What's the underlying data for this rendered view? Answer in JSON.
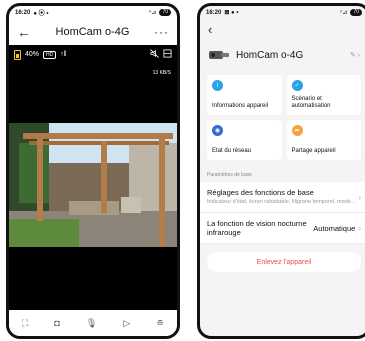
{
  "phone1": {
    "status": {
      "time": "16:20",
      "battery": "70"
    },
    "header": {
      "title": "HomCam o-4G"
    },
    "cam": {
      "battery_pct": "40%",
      "quality": "HD",
      "speed": "13 KB/S"
    },
    "bottom_icons": [
      "fullscreen-icon",
      "screenshot-icon",
      "microphone-icon",
      "record-icon",
      "menu-icon"
    ]
  },
  "phone2": {
    "status": {
      "time": "16:20",
      "battery": "70"
    },
    "device_name": "HomCam o-4G",
    "tiles": [
      {
        "label": "Informations appareil",
        "color": "#2aa3e5"
      },
      {
        "label": "Scénario et automatisation",
        "color": "#2aa3e5"
      },
      {
        "label": "Etat du réseau",
        "color": "#2f6bd6"
      },
      {
        "label": "Partage appareil",
        "color": "#f5a33a"
      }
    ],
    "section_label": "Paramètres de base",
    "settings": {
      "basic": {
        "title": "Réglages des fonctions de base",
        "subtitle": "Indicateur d'état, écran rabattable, filigrane temporel, mode..."
      },
      "night": {
        "title": "La fonction de vision nocturne infrarouge",
        "value": "Automatique"
      }
    },
    "remove_label": "Enlevez l'appareil"
  }
}
